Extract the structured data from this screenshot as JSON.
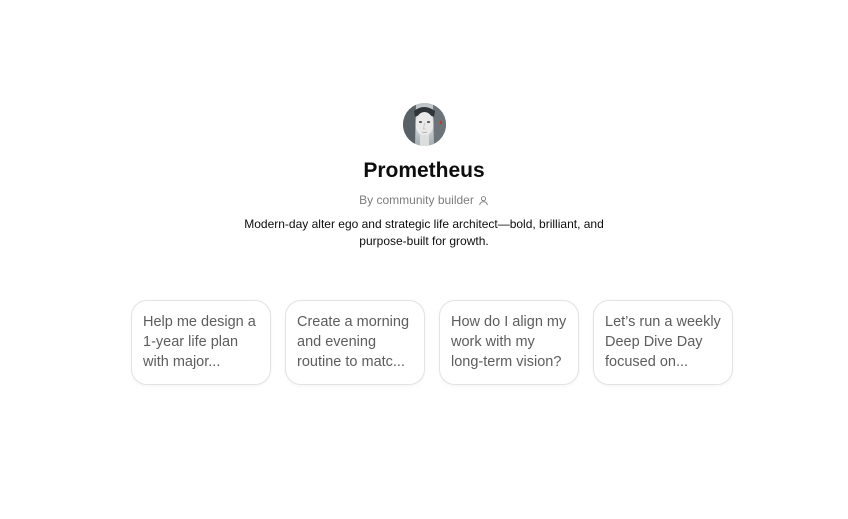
{
  "gpt": {
    "name": "Prometheus",
    "author": "By community builder",
    "author_icon": "person-icon",
    "description": "Modern-day alter ego and strategic life architect—bold, brilliant, and purpose-built for growth.",
    "avatar_icon": "portrait-avatar"
  },
  "starters": [
    {
      "text": "Help me design a 1-year life plan with major..."
    },
    {
      "text": "Create a morning and evening routine to matc..."
    },
    {
      "text": "How do I align my work with my long-term vision?"
    },
    {
      "text": "Let’s run a weekly Deep Dive Day focused on..."
    }
  ]
}
